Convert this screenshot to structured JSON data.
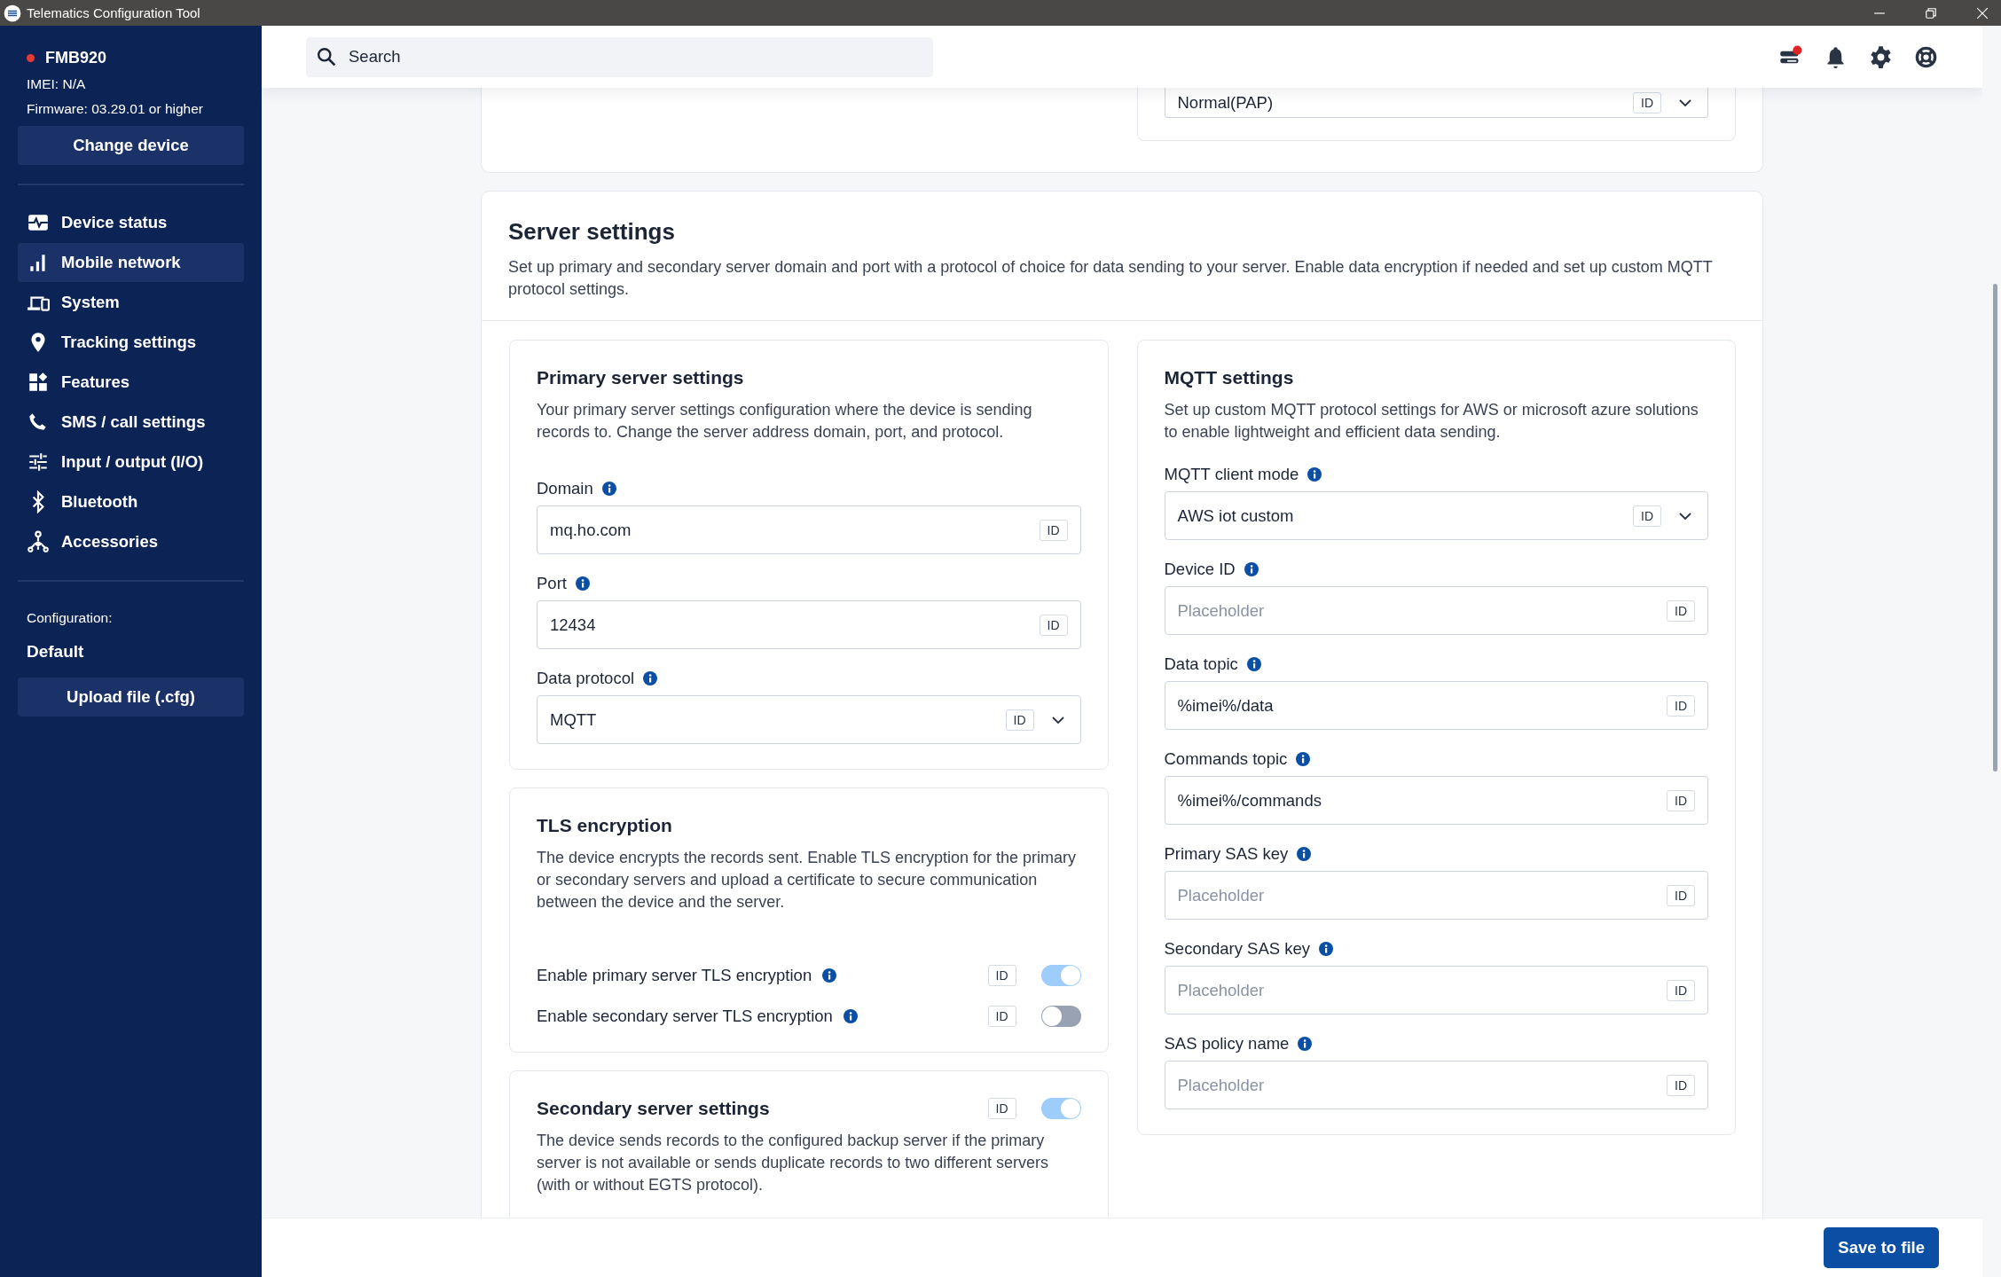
{
  "window": {
    "title": "Telematics Configuration Tool"
  },
  "device": {
    "name": "FMB920",
    "connected": false,
    "imei": "IMEI: N/A",
    "firmware": "Firmware: 03.29.01 or higher",
    "change_button": "Change device"
  },
  "sidebar": {
    "items": [
      {
        "label": "Device status",
        "kind": "status",
        "selected": false
      },
      {
        "label": "Mobile network",
        "kind": "network",
        "selected": true
      },
      {
        "label": "System",
        "kind": "system",
        "selected": false
      },
      {
        "label": "Tracking settings",
        "kind": "tracking",
        "selected": false
      },
      {
        "label": "Features",
        "kind": "features",
        "selected": false
      },
      {
        "label": "SMS / call settings",
        "kind": "phone",
        "selected": false
      },
      {
        "label": "Input / output (I/O)",
        "kind": "io",
        "selected": false
      },
      {
        "label": "Bluetooth",
        "kind": "bluetooth",
        "selected": false
      },
      {
        "label": "Accessories",
        "kind": "accessories",
        "selected": false
      }
    ]
  },
  "configuration": {
    "label": "Configuration:",
    "value": "Default",
    "upload_button": "Upload file (.cfg)"
  },
  "search": {
    "placeholder": "Search"
  },
  "header": {
    "queue_alert": true
  },
  "top_card": {
    "field": {
      "value": "Normal(PAP)",
      "badge": "ID",
      "kind": "select"
    }
  },
  "server_settings": {
    "title": "Server settings",
    "description": "Set up primary and secondary server domain and port with a protocol of choice for data sending to your server. Enable data encryption if needed and set up custom MQTT protocol settings.",
    "primary": {
      "title": "Primary server settings",
      "description": "Your primary server settings configuration where the device is sending records to. Change the server address domain, port, and protocol.",
      "fields": [
        {
          "label": "Domain",
          "value": "mq.ho.com",
          "badge": "ID",
          "kind": "text"
        },
        {
          "label": "Port",
          "value": "12434",
          "badge": "ID",
          "kind": "text"
        },
        {
          "label": "Data protocol",
          "value": "MQTT",
          "badge": "ID",
          "kind": "select"
        }
      ]
    },
    "tls": {
      "title": "TLS encryption",
      "description": "The device encrypts the records sent. Enable TLS encryption for the primary or secondary servers and upload a certificate to secure communication between the device and the server.",
      "toggles": [
        {
          "label": "Enable primary server TLS encryption",
          "badge": "ID",
          "on": true
        },
        {
          "label": "Enable secondary server TLS encryption",
          "badge": "ID",
          "on": false
        }
      ]
    },
    "secondary": {
      "title": "Secondary server settings",
      "badge": "ID",
      "on": true,
      "description": "The device sends records to the configured backup server if the primary server is not available or sends duplicate records to two different servers (with or without EGTS protocol)."
    },
    "mqtt": {
      "title": "MQTT settings",
      "description": "Set up custom MQTT protocol settings for AWS or microsoft azure solutions to enable lightweight and efficient data sending.",
      "fields": [
        {
          "label": "MQTT client mode",
          "value": "AWS iot custom",
          "badge": "ID",
          "kind": "select"
        },
        {
          "label": "Device ID",
          "placeholder": "Placeholder",
          "badge": "ID",
          "kind": "text"
        },
        {
          "label": "Data topic",
          "value": "%imei%/data",
          "badge": "ID",
          "kind": "text"
        },
        {
          "label": "Commands topic",
          "value": "%imei%/commands",
          "badge": "ID",
          "kind": "text"
        },
        {
          "label": "Primary SAS key",
          "placeholder": "Placeholder",
          "badge": "ID",
          "kind": "text"
        },
        {
          "label": "Secondary SAS key",
          "placeholder": "Placeholder",
          "badge": "ID",
          "kind": "text"
        },
        {
          "label": "SAS policy name",
          "placeholder": "Placeholder",
          "badge": "ID",
          "kind": "text"
        }
      ]
    }
  },
  "footer": {
    "save_button": "Save to file"
  }
}
